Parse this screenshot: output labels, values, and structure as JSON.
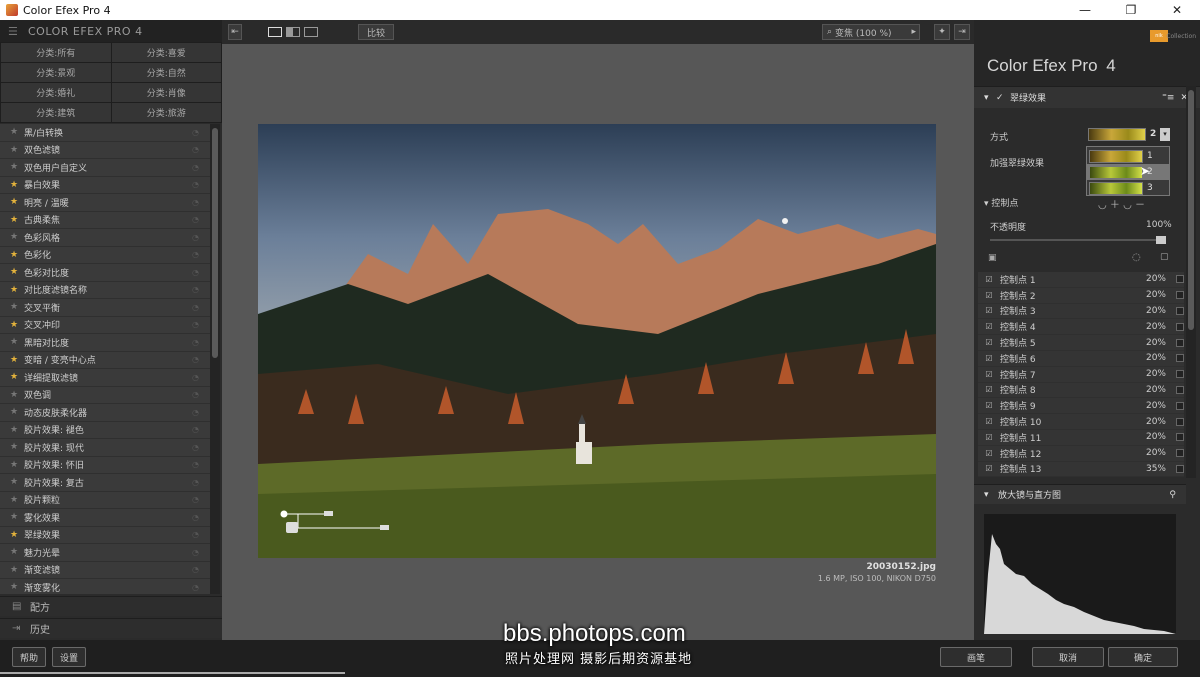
{
  "window": {
    "title": "Color Efex Pro 4",
    "controls": [
      "—",
      "❐",
      "✕"
    ]
  },
  "left_panel": {
    "brand": "COLOR EFEX PRO 4",
    "categories": [
      "分类:所有",
      "分类:喜爱",
      "分类:景观",
      "分类:自然",
      "分类:婚礼",
      "分类:肖像",
      "分类:建筑",
      "分类:旅游"
    ],
    "filters": [
      {
        "label": "黑/白转换",
        "fav": false
      },
      {
        "label": "双色滤镜",
        "fav": false
      },
      {
        "label": "双色用户自定义",
        "fav": false
      },
      {
        "label": "暴白效果",
        "fav": true
      },
      {
        "label": "明亮 / 温暖",
        "fav": true
      },
      {
        "label": "古典柔焦",
        "fav": true
      },
      {
        "label": "色彩风格",
        "fav": false
      },
      {
        "label": "色彩化",
        "fav": true
      },
      {
        "label": "色彩对比度",
        "fav": true
      },
      {
        "label": "对比度滤镜名称",
        "fav": true
      },
      {
        "label": "交叉平衡",
        "fav": false
      },
      {
        "label": "交叉冲印",
        "fav": true
      },
      {
        "label": "黑暗对比度",
        "fav": false
      },
      {
        "label": "变暗 / 变亮中心点",
        "fav": true
      },
      {
        "label": "详细提取滤镜",
        "fav": true
      },
      {
        "label": "双色调",
        "fav": false
      },
      {
        "label": "动态皮肤柔化器",
        "fav": false
      },
      {
        "label": "胶片效果: 褪色",
        "fav": false
      },
      {
        "label": "胶片效果: 现代",
        "fav": false
      },
      {
        "label": "胶片效果: 怀旧",
        "fav": false
      },
      {
        "label": "胶片效果: 复古",
        "fav": false
      },
      {
        "label": "胶片颗粒",
        "fav": false
      },
      {
        "label": "雾化效果",
        "fav": false
      },
      {
        "label": "翠绿效果",
        "fav": true
      },
      {
        "label": "魅力光晕",
        "fav": false
      },
      {
        "label": "渐变滤镜",
        "fav": false
      },
      {
        "label": "渐变雾化",
        "fav": false
      }
    ],
    "recipes_label": "配方",
    "history_label": "历史"
  },
  "toolbar": {
    "compare_label": "比较",
    "zoom_label": "变焦 (100 %)"
  },
  "image": {
    "filename": "20030152.jpg",
    "meta": "1.6 MP, ISO 100, NIKON D750"
  },
  "right_panel": {
    "brand_badge": "nik",
    "collection": "Collection",
    "title": "Color Efex Pro",
    "version": "4",
    "filter_name": "翠绿效果",
    "method_label": "方式",
    "enhance_label": "加强翠绿效果",
    "method_value": "2",
    "presets": [
      "1",
      "2",
      "3"
    ],
    "control_points_label": "控制点",
    "opacity_label": "不透明度",
    "opacity_value": "100%",
    "opacity_level": 1.0,
    "control_points": [
      {
        "name": "控制点 1",
        "pct": "20%"
      },
      {
        "name": "控制点 2",
        "pct": "20%"
      },
      {
        "name": "控制点 3",
        "pct": "20%"
      },
      {
        "name": "控制点 4",
        "pct": "20%"
      },
      {
        "name": "控制点 5",
        "pct": "20%"
      },
      {
        "name": "控制点 6",
        "pct": "20%"
      },
      {
        "name": "控制点 7",
        "pct": "20%"
      },
      {
        "name": "控制点 8",
        "pct": "20%"
      },
      {
        "name": "控制点 9",
        "pct": "20%"
      },
      {
        "name": "控制点 10",
        "pct": "20%"
      },
      {
        "name": "控制点 11",
        "pct": "20%"
      },
      {
        "name": "控制点 12",
        "pct": "20%"
      },
      {
        "name": "控制点 13",
        "pct": "35%"
      }
    ],
    "histogram_label": "放大镜与直方图"
  },
  "bottom": {
    "help_label": "帮助",
    "settings_label": "设置",
    "brush_label": "画笔",
    "cancel_label": "取消",
    "ok_label": "确定"
  },
  "watermark": {
    "line1": "bbs.photops.com",
    "line2": "照片处理网 摄影后期资源基地"
  },
  "colors": {
    "accent_star": "#e3b23c",
    "brand_orange": "#e89a2c",
    "panel_bg": "#2b2b2b",
    "canvas_bg": "#575757"
  }
}
